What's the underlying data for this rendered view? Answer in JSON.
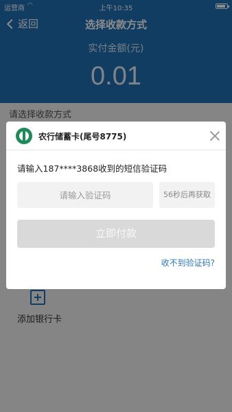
{
  "status_bar": {
    "carrier": "运营商",
    "time": "上午10:35"
  },
  "nav": {
    "back_label": "返回",
    "title": "选择收款方式"
  },
  "amount": {
    "label": "实付金额(元)",
    "value": "0.01"
  },
  "choose_label": "请选择收款方式",
  "add_card": {
    "label": "添加银行卡"
  },
  "modal": {
    "bank_name": "农行储蓄卡(尾号8775)",
    "sms_hint": "请输入187****3868收到的短信验证码",
    "code_placeholder": "请输入验证码",
    "resend_label": "56秒后再获取",
    "pay_label": "立即付款",
    "no_code_link": "收不到验证码?"
  },
  "colors": {
    "header_blue": "#1f6fb2",
    "bank_green": "#1d8a5a",
    "link_blue": "#2d78c4",
    "disabled_button": "#d9d9d9"
  }
}
